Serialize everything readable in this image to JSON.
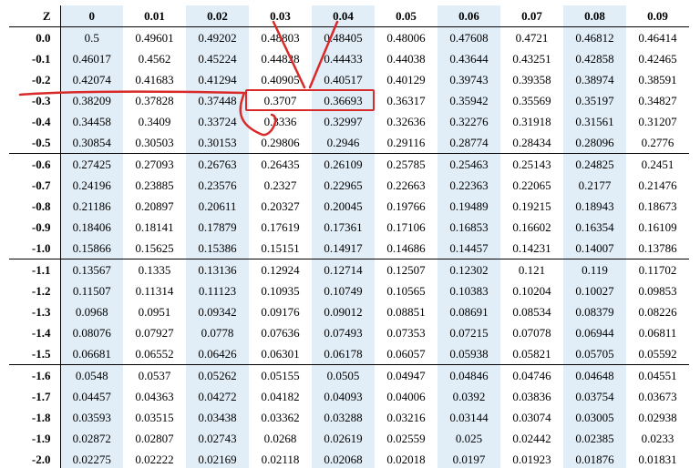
{
  "chart_data": {
    "type": "table",
    "title": "Standard Normal (Z) Cumulative Distribution — negative Z",
    "z_label": "Z",
    "col_headers": [
      "0",
      "0.01",
      "0.02",
      "0.03",
      "0.04",
      "0.05",
      "0.06",
      "0.07",
      "0.08",
      "0.09"
    ],
    "row_headers": [
      "0.0",
      "-0.1",
      "-0.2",
      "-0.3",
      "-0.4",
      "-0.5",
      "-0.6",
      "-0.7",
      "-0.8",
      "-0.9",
      "-1.0",
      "-1.1",
      "-1.2",
      "-1.3",
      "-1.4",
      "-1.5",
      "-1.6",
      "-1.7",
      "-1.8",
      "-1.9",
      "-2.0"
    ],
    "rows": [
      [
        "0.5",
        "0.49601",
        "0.49202",
        "0.48803",
        "0.48405",
        "0.48006",
        "0.47608",
        "0.4721",
        "0.46812",
        "0.46414"
      ],
      [
        "0.46017",
        "0.4562",
        "0.45224",
        "0.44828",
        "0.44433",
        "0.44038",
        "0.43644",
        "0.43251",
        "0.42858",
        "0.42465"
      ],
      [
        "0.42074",
        "0.41683",
        "0.41294",
        "0.40905",
        "0.40517",
        "0.40129",
        "0.39743",
        "0.39358",
        "0.38974",
        "0.38591"
      ],
      [
        "0.38209",
        "0.37828",
        "0.37448",
        "0.3707",
        "0.36693",
        "0.36317",
        "0.35942",
        "0.35569",
        "0.35197",
        "0.34827"
      ],
      [
        "0.34458",
        "0.3409",
        "0.33724",
        "0.3336",
        "0.32997",
        "0.32636",
        "0.32276",
        "0.31918",
        "0.31561",
        "0.31207"
      ],
      [
        "0.30854",
        "0.30503",
        "0.30153",
        "0.29806",
        "0.2946",
        "0.29116",
        "0.28774",
        "0.28434",
        "0.28096",
        "0.2776"
      ],
      [
        "0.27425",
        "0.27093",
        "0.26763",
        "0.26435",
        "0.26109",
        "0.25785",
        "0.25463",
        "0.25143",
        "0.24825",
        "0.2451"
      ],
      [
        "0.24196",
        "0.23885",
        "0.23576",
        "0.2327",
        "0.22965",
        "0.22663",
        "0.22363",
        "0.22065",
        "0.2177",
        "0.21476"
      ],
      [
        "0.21186",
        "0.20897",
        "0.20611",
        "0.20327",
        "0.20045",
        "0.19766",
        "0.19489",
        "0.19215",
        "0.18943",
        "0.18673"
      ],
      [
        "0.18406",
        "0.18141",
        "0.17879",
        "0.17619",
        "0.17361",
        "0.17106",
        "0.16853",
        "0.16602",
        "0.16354",
        "0.16109"
      ],
      [
        "0.15866",
        "0.15625",
        "0.15386",
        "0.15151",
        "0.14917",
        "0.14686",
        "0.14457",
        "0.14231",
        "0.14007",
        "0.13786"
      ],
      [
        "0.13567",
        "0.1335",
        "0.13136",
        "0.12924",
        "0.12714",
        "0.12507",
        "0.12302",
        "0.121",
        "0.119",
        "0.11702"
      ],
      [
        "0.11507",
        "0.11314",
        "0.11123",
        "0.10935",
        "0.10749",
        "0.10565",
        "0.10383",
        "0.10204",
        "0.10027",
        "0.09853"
      ],
      [
        "0.0968",
        "0.0951",
        "0.09342",
        "0.09176",
        "0.09012",
        "0.08851",
        "0.08691",
        "0.08534",
        "0.08379",
        "0.08226"
      ],
      [
        "0.08076",
        "0.07927",
        "0.0778",
        "0.07636",
        "0.07493",
        "0.07353",
        "0.07215",
        "0.07078",
        "0.06944",
        "0.06811"
      ],
      [
        "0.06681",
        "0.06552",
        "0.06426",
        "0.06301",
        "0.06178",
        "0.06057",
        "0.05938",
        "0.05821",
        "0.05705",
        "0.05592"
      ],
      [
        "0.0548",
        "0.0537",
        "0.05262",
        "0.05155",
        "0.0505",
        "0.04947",
        "0.04846",
        "0.04746",
        "0.04648",
        "0.04551"
      ],
      [
        "0.04457",
        "0.04363",
        "0.04272",
        "0.04182",
        "0.04093",
        "0.04006",
        "0.0392",
        "0.03836",
        "0.03754",
        "0.03673"
      ],
      [
        "0.03593",
        "0.03515",
        "0.03438",
        "0.03362",
        "0.03288",
        "0.03216",
        "0.03144",
        "0.03074",
        "0.03005",
        "0.02938"
      ],
      [
        "0.02872",
        "0.02807",
        "0.02743",
        "0.0268",
        "0.02619",
        "0.02559",
        "0.025",
        "0.02442",
        "0.02385",
        "0.0233"
      ],
      [
        "0.02275",
        "0.02222",
        "0.02169",
        "0.02118",
        "0.02068",
        "0.02018",
        "0.0197",
        "0.01923",
        "0.01876",
        "0.01831"
      ]
    ],
    "shaded_columns_zero_based": [
      0,
      2,
      4,
      6,
      8
    ],
    "highlight": {
      "row_header": "-0.3",
      "col_headers": [
        "0.03",
        "0.04"
      ],
      "values": [
        "0.3707",
        "0.36693"
      ]
    },
    "group_separators_after_rows": [
      "-0.5",
      "-1.0",
      "-1.5"
    ]
  }
}
